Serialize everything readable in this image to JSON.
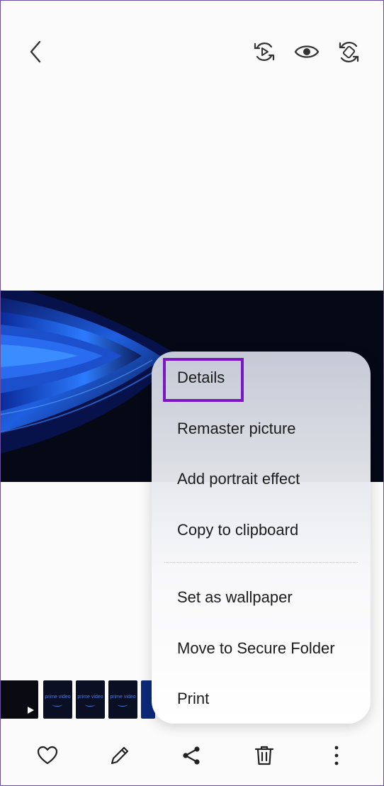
{
  "top_bar": {
    "back_icon": "chevron-left-icon",
    "remaster_icon": "remaster-play-icon",
    "view_icon": "eye-icon",
    "rotate_icon": "auto-rotate-icon"
  },
  "photo": {
    "description_icon": "abstract-blue-waves"
  },
  "filmstrip": {
    "thumb_text": "prime video"
  },
  "context_menu": {
    "items": [
      "Details",
      "Remaster picture",
      "Add portrait effect",
      "Copy to clipboard",
      "Set as wallpaper",
      "Move to Secure Folder",
      "Print"
    ],
    "highlight_color": "#7b16c4"
  },
  "bottom_bar": {
    "favorite_icon": "heart-icon",
    "edit_icon": "pencil-icon",
    "share_icon": "share-icon",
    "delete_icon": "trash-icon",
    "more_icon": "more-vertical-icon"
  }
}
